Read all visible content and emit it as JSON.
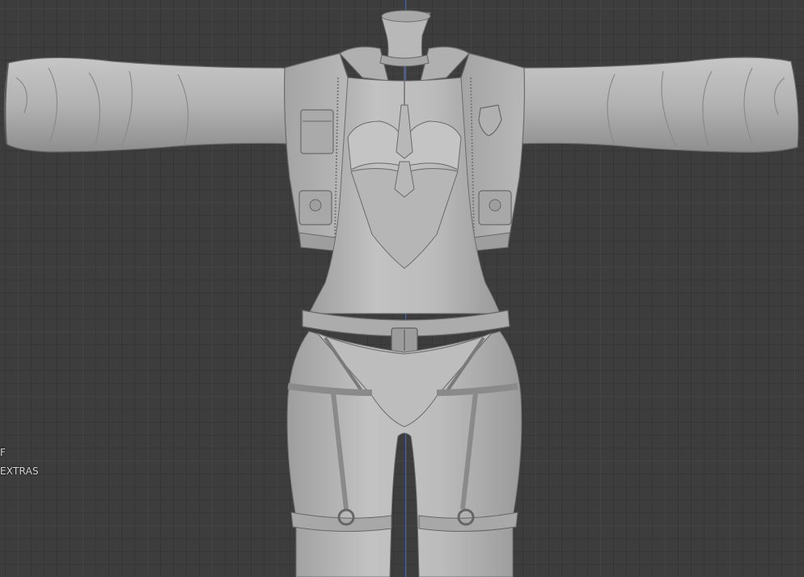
{
  "viewport": {
    "mode": "3d-viewport",
    "background_color": "#3d3d3d",
    "grid_color": "#4a4a4a",
    "z_axis_color": "#3b63c9",
    "mesh_color": "#b4b4b4"
  },
  "overlay": {
    "lines": [
      "F",
      "EXTRAS"
    ]
  },
  "model": {
    "name": ""
  }
}
